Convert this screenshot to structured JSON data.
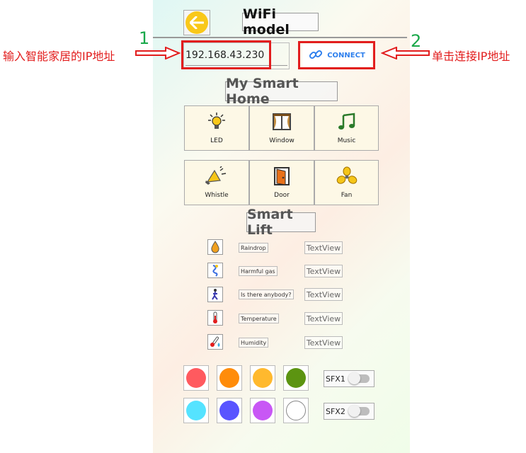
{
  "app": {
    "title": "WiFi model"
  },
  "ip_input": {
    "value": "192.168.43.230"
  },
  "connect_button": {
    "label": "CONNECT"
  },
  "annotations": {
    "step1_number": "1",
    "step1_text": "输入智能家居的IP地址",
    "step2_number": "2",
    "step2_text": "单击连接IP地址"
  },
  "home_section": {
    "title": "My Smart Home",
    "tiles": [
      {
        "label": "LED",
        "icon": "bulb-icon"
      },
      {
        "label": "Window",
        "icon": "window-icon"
      },
      {
        "label": "Music",
        "icon": "music-note-icon"
      },
      {
        "label": "Whistle",
        "icon": "horn-icon"
      },
      {
        "label": "Door",
        "icon": "door-icon"
      },
      {
        "label": "Fan",
        "icon": "fan-icon"
      }
    ]
  },
  "lift_section": {
    "title": "Smart Lift",
    "sensors": [
      {
        "label": "Raindrop",
        "value": "TextView",
        "icon": "raindrop-icon"
      },
      {
        "label": "Harmful gas",
        "value": "TextView",
        "icon": "gas-icon"
      },
      {
        "label": "Is there anybody?",
        "value": "TextView",
        "icon": "person-icon"
      },
      {
        "label": "Temperature",
        "value": "TextView",
        "icon": "thermometer-icon"
      },
      {
        "label": "Humidity",
        "value": "TextView",
        "icon": "humidity-icon"
      }
    ]
  },
  "color_buttons": [
    "#ff5a5f",
    "#ff8c0a",
    "#ffb92e",
    "#5c9411",
    "#55e3ff",
    "#5954ff",
    "#c857f5",
    "#ffffff"
  ],
  "switches": [
    {
      "label": "SFX1",
      "on": false
    },
    {
      "label": "SFX2",
      "on": false
    }
  ],
  "colors": {
    "accent": "#2f80ed",
    "annotation_red": "#e21d1d",
    "annotation_green": "#19a84a",
    "back_button": "#f9c81a"
  }
}
